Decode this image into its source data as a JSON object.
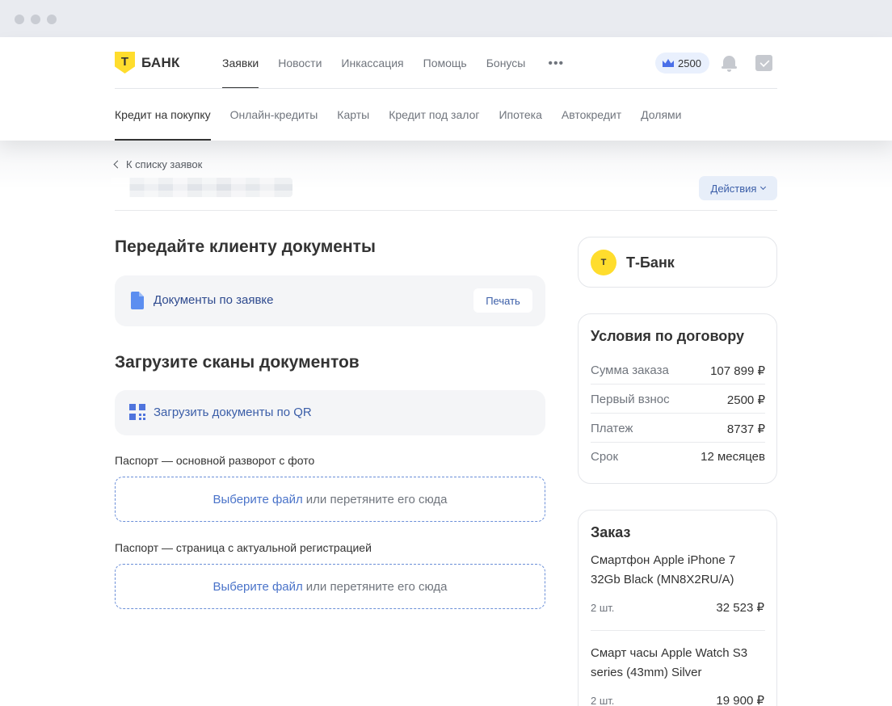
{
  "header": {
    "logo_letter": "Т",
    "logo_text": "БАНК",
    "nav": [
      "Заявки",
      "Новости",
      "Инкассация",
      "Помощь",
      "Бонусы"
    ],
    "more": "•••",
    "balance": "2500",
    "subnav": [
      "Кредит на покупку",
      "Онлайн-кредиты",
      "Карты",
      "Кредит под залог",
      "Ипотека",
      "Автокредит",
      "Долями"
    ]
  },
  "page": {
    "back_label": "К списку заявок",
    "actions_label": "Действия"
  },
  "documents": {
    "title": "Передайте клиенту документы",
    "link": "Документы по заявке",
    "print_label": "Печать"
  },
  "upload": {
    "title": "Загрузите сканы документов",
    "qr_link": "Загрузить документы по QR",
    "fields": [
      {
        "label": "Паспорт — основной разворот с фото",
        "pick": "Выберите файл",
        "rest": "или перетяните его сюда"
      },
      {
        "label": "Паспорт — страница с актуальной регистрацией",
        "pick": "Выберите файл",
        "rest": "или перетяните его сюда"
      }
    ]
  },
  "bank_card": {
    "logo_letter": "Т",
    "name": "Т-Банк"
  },
  "contract": {
    "title": "Условия по договору",
    "rows": [
      {
        "k": "Сумма заказа",
        "v": "107 899 ₽"
      },
      {
        "k": "Первый взнос",
        "v": "2500 ₽"
      },
      {
        "k": "Платеж",
        "v": "8737 ₽"
      },
      {
        "k": "Срок",
        "v": "12 месяцев"
      }
    ]
  },
  "order": {
    "title": "Заказ",
    "items": [
      {
        "name": "Смартфон Apple iPhone 7 32Gb Black (MN8X2RU/A)",
        "qty": "2 шт.",
        "price": "32 523 ₽"
      },
      {
        "name": "Смарт часы Apple Watch S3 series (43mm) Silver",
        "qty": "2 шт.",
        "price": "19 900 ₽"
      }
    ]
  },
  "colors": {
    "brand_yellow": "#ffdd2d",
    "link_blue": "#2f4b8f",
    "accent_blue": "#4a73c9"
  }
}
